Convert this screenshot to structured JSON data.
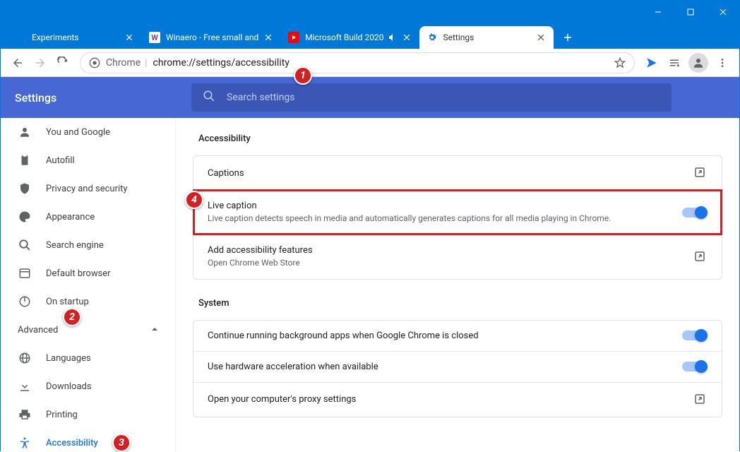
{
  "window": {
    "min": "–",
    "max": "☐",
    "close": "✕"
  },
  "tabs": [
    {
      "title": "Experiments",
      "favicon": "flask"
    },
    {
      "title": "Winaero - Free small and",
      "favicon": "w"
    },
    {
      "title": "Microsoft Build 2020",
      "favicon": "yt",
      "audio": true
    },
    {
      "title": "Settings",
      "favicon": "gear",
      "active": true
    }
  ],
  "newtab_symbol": "+",
  "toolbar": {
    "chrome_label": "Chrome",
    "url": "chrome://settings/accessibility"
  },
  "header": {
    "title": "Settings",
    "search_placeholder": "Search settings"
  },
  "sidebar": {
    "items": [
      {
        "label": "You and Google",
        "icon": "person"
      },
      {
        "label": "Autofill",
        "icon": "clipboard"
      },
      {
        "label": "Privacy and security",
        "icon": "shield"
      },
      {
        "label": "Appearance",
        "icon": "palette"
      },
      {
        "label": "Search engine",
        "icon": "search"
      },
      {
        "label": "Default browser",
        "icon": "browser"
      },
      {
        "label": "On startup",
        "icon": "power"
      }
    ],
    "advanced_label": "Advanced",
    "advanced_items": [
      {
        "label": "Languages",
        "icon": "globe"
      },
      {
        "label": "Downloads",
        "icon": "download"
      },
      {
        "label": "Printing",
        "icon": "printer"
      },
      {
        "label": "Accessibility",
        "icon": "a11y",
        "selected": true
      }
    ]
  },
  "page": {
    "section1_title": "Accessibility",
    "captions_label": "Captions",
    "live_caption_title": "Live caption",
    "live_caption_desc": "Live caption detects speech in media and automatically generates captions for all media playing in Chrome.",
    "add_features_title": "Add accessibility features",
    "add_features_desc": "Open Chrome Web Store",
    "section2_title": "System",
    "system_rows": [
      "Continue running background apps when Google Chrome is closed",
      "Use hardware acceleration when available",
      "Open your computer's proxy settings"
    ]
  },
  "badges": {
    "1": "1",
    "2": "2",
    "3": "3",
    "4": "4"
  }
}
